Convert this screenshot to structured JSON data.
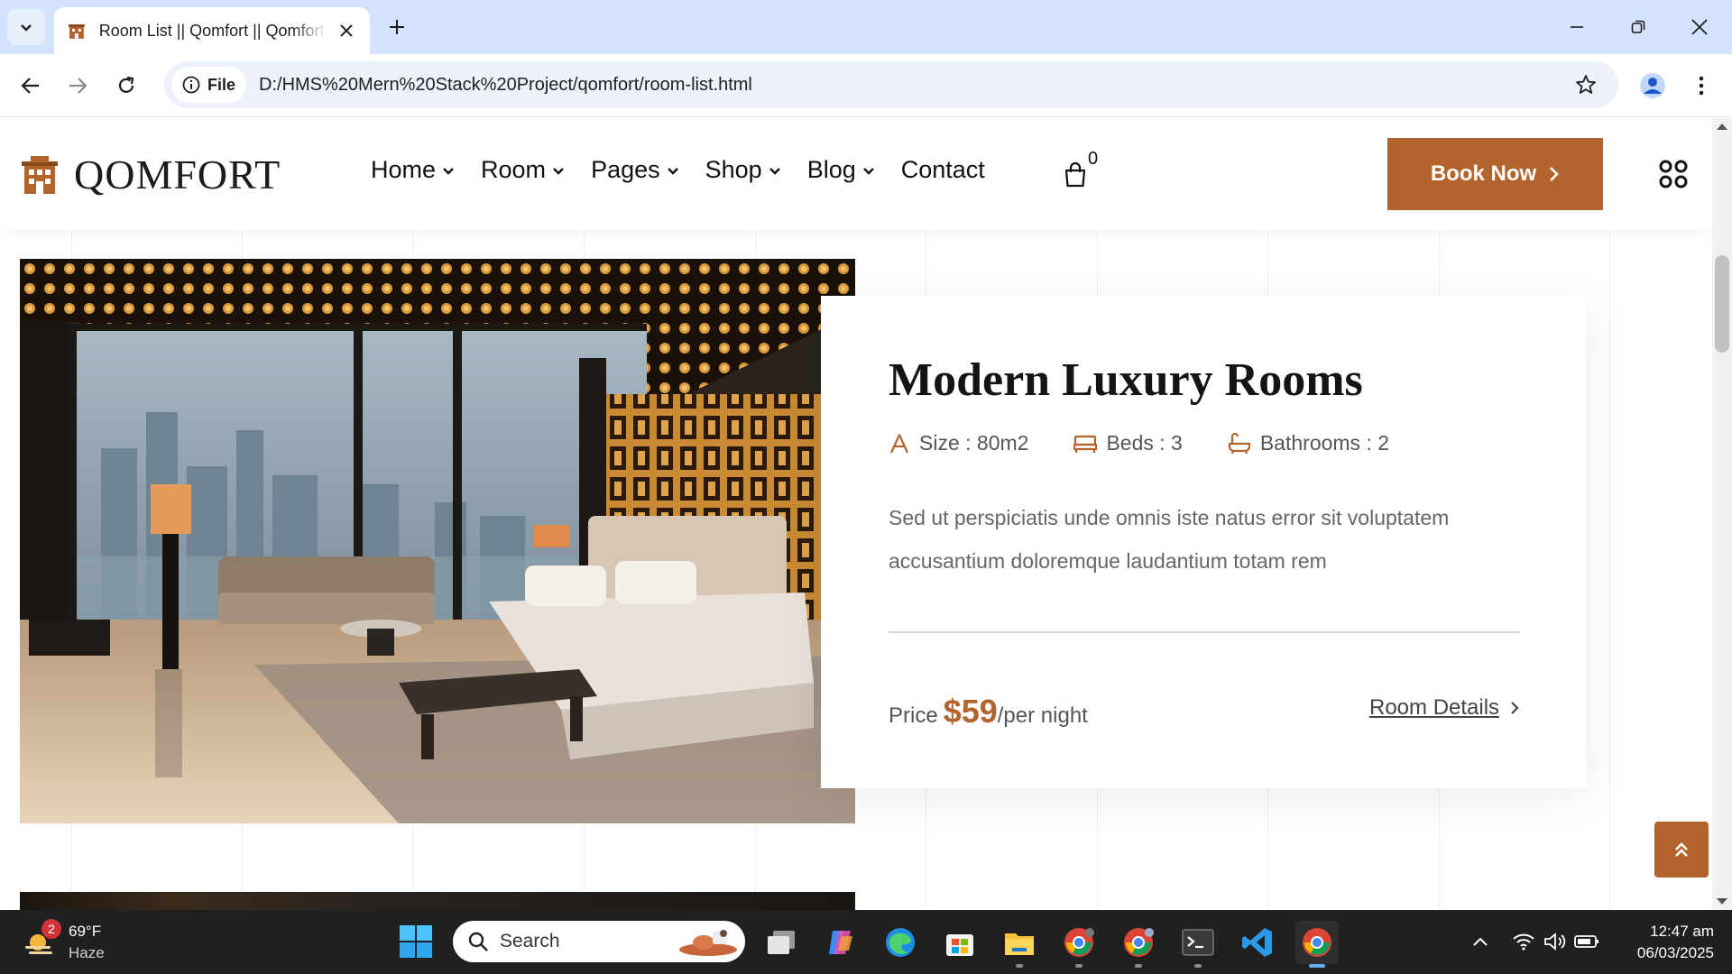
{
  "browser": {
    "tab_title": "Room List || Qomfort || Qomfort",
    "url_chip": "File",
    "url": "D:/HMS%20Mern%20Stack%20Project/qomfort/room-list.html"
  },
  "site": {
    "logo_text": "QOMFORT",
    "nav": [
      {
        "label": "Home"
      },
      {
        "label": "Room"
      },
      {
        "label": "Pages"
      },
      {
        "label": "Shop"
      },
      {
        "label": "Blog"
      },
      {
        "label": "Contact"
      }
    ],
    "cart_count": "0",
    "book_now": "Book Now"
  },
  "room": {
    "title": "Modern Luxury Rooms",
    "size": "Size : 80m2",
    "beds": "Beds : 3",
    "bathrooms": "Bathrooms : 2",
    "description": "Sed ut perspiciatis unde omnis iste natus error sit voluptatem accusantium doloremque laudantium totam rem",
    "price_label": "Price",
    "price": "$59",
    "price_unit": "/per night",
    "details_link": "Room Details"
  },
  "taskbar": {
    "weather_temp": "69°F",
    "weather_desc": "Haze",
    "weather_badge": "2",
    "search_placeholder": "Search",
    "time": "12:47 am",
    "date": "06/03/2025"
  },
  "colors": {
    "accent": "#b3642c",
    "tabstrip": "#d3e3fd",
    "taskbar": "#202020"
  },
  "icons": [
    "tab-search-icon",
    "hotel-favicon-icon",
    "close-icon",
    "plus-icon",
    "minimize-icon",
    "restore-icon",
    "back-icon",
    "forward-icon",
    "reload-icon",
    "info-icon",
    "star-icon",
    "profile-icon",
    "kebab-menu-icon",
    "chevron-down-icon",
    "cart-icon",
    "chevron-right-icon",
    "grid-menu-icon",
    "ruler-icon",
    "bed-icon",
    "bathtub-icon",
    "double-chevron-up-icon",
    "windows-start-icon",
    "search-icon",
    "wifi-icon",
    "volume-icon",
    "battery-icon"
  ]
}
